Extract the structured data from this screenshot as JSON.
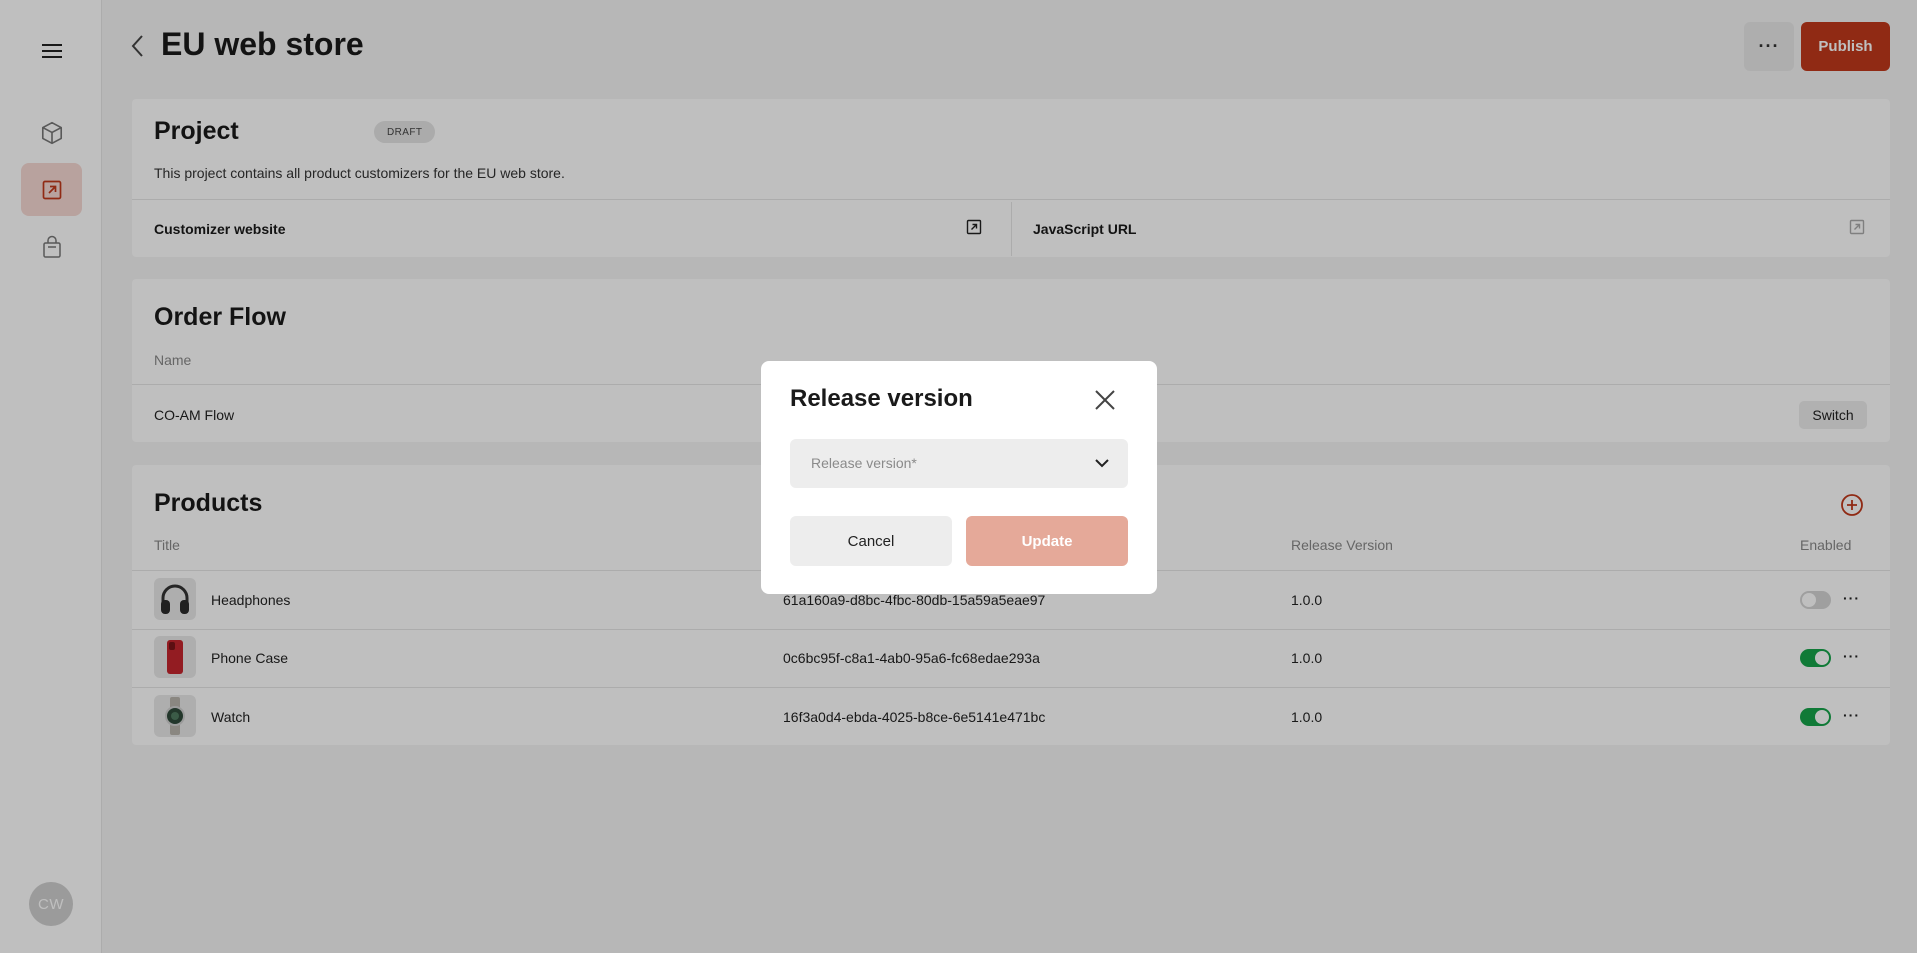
{
  "sidebar": {
    "menu_icon": "hamburger-menu-icon",
    "items": [
      {
        "icon": "cube-icon"
      },
      {
        "icon": "external-link-square-icon",
        "active": true
      },
      {
        "icon": "shopping-bag-icon"
      }
    ],
    "avatar_initials": "CW"
  },
  "header": {
    "title": "EU web store",
    "more_label": "···",
    "publish_label": "Publish"
  },
  "project": {
    "title": "Project",
    "badge": "DRAFT",
    "description": "This project contains all product customizers for the EU web store.",
    "customizer_label": "Customizer website",
    "javascript_label": "JavaScript URL"
  },
  "order_flow": {
    "title": "Order Flow",
    "name_header": "Name",
    "flow_name": "CO-AM Flow",
    "switch_label": "Switch"
  },
  "products": {
    "title": "Products",
    "headers": {
      "title": "Title",
      "release_version": "Release Version",
      "enabled": "Enabled"
    },
    "rows": [
      {
        "name": "Headphones",
        "id": "61a160a9-d8bc-4fbc-80db-15a59a5eae97",
        "version": "1.0.0",
        "enabled": false
      },
      {
        "name": "Phone Case",
        "id": "0c6bc95f-c8a1-4ab0-95a6-fc68edae293a",
        "version": "1.0.0",
        "enabled": true
      },
      {
        "name": "Watch",
        "id": "16f3a0d4-ebda-4025-b8ce-6e5141e471bc",
        "version": "1.0.0",
        "enabled": true
      }
    ]
  },
  "modal": {
    "title": "Release version",
    "select_placeholder": "Release version*",
    "cancel_label": "Cancel",
    "update_label": "Update"
  },
  "colors": {
    "accent": "#c0391b",
    "accent_disabled": "#e5a999",
    "toggle_on": "#16a34a"
  }
}
